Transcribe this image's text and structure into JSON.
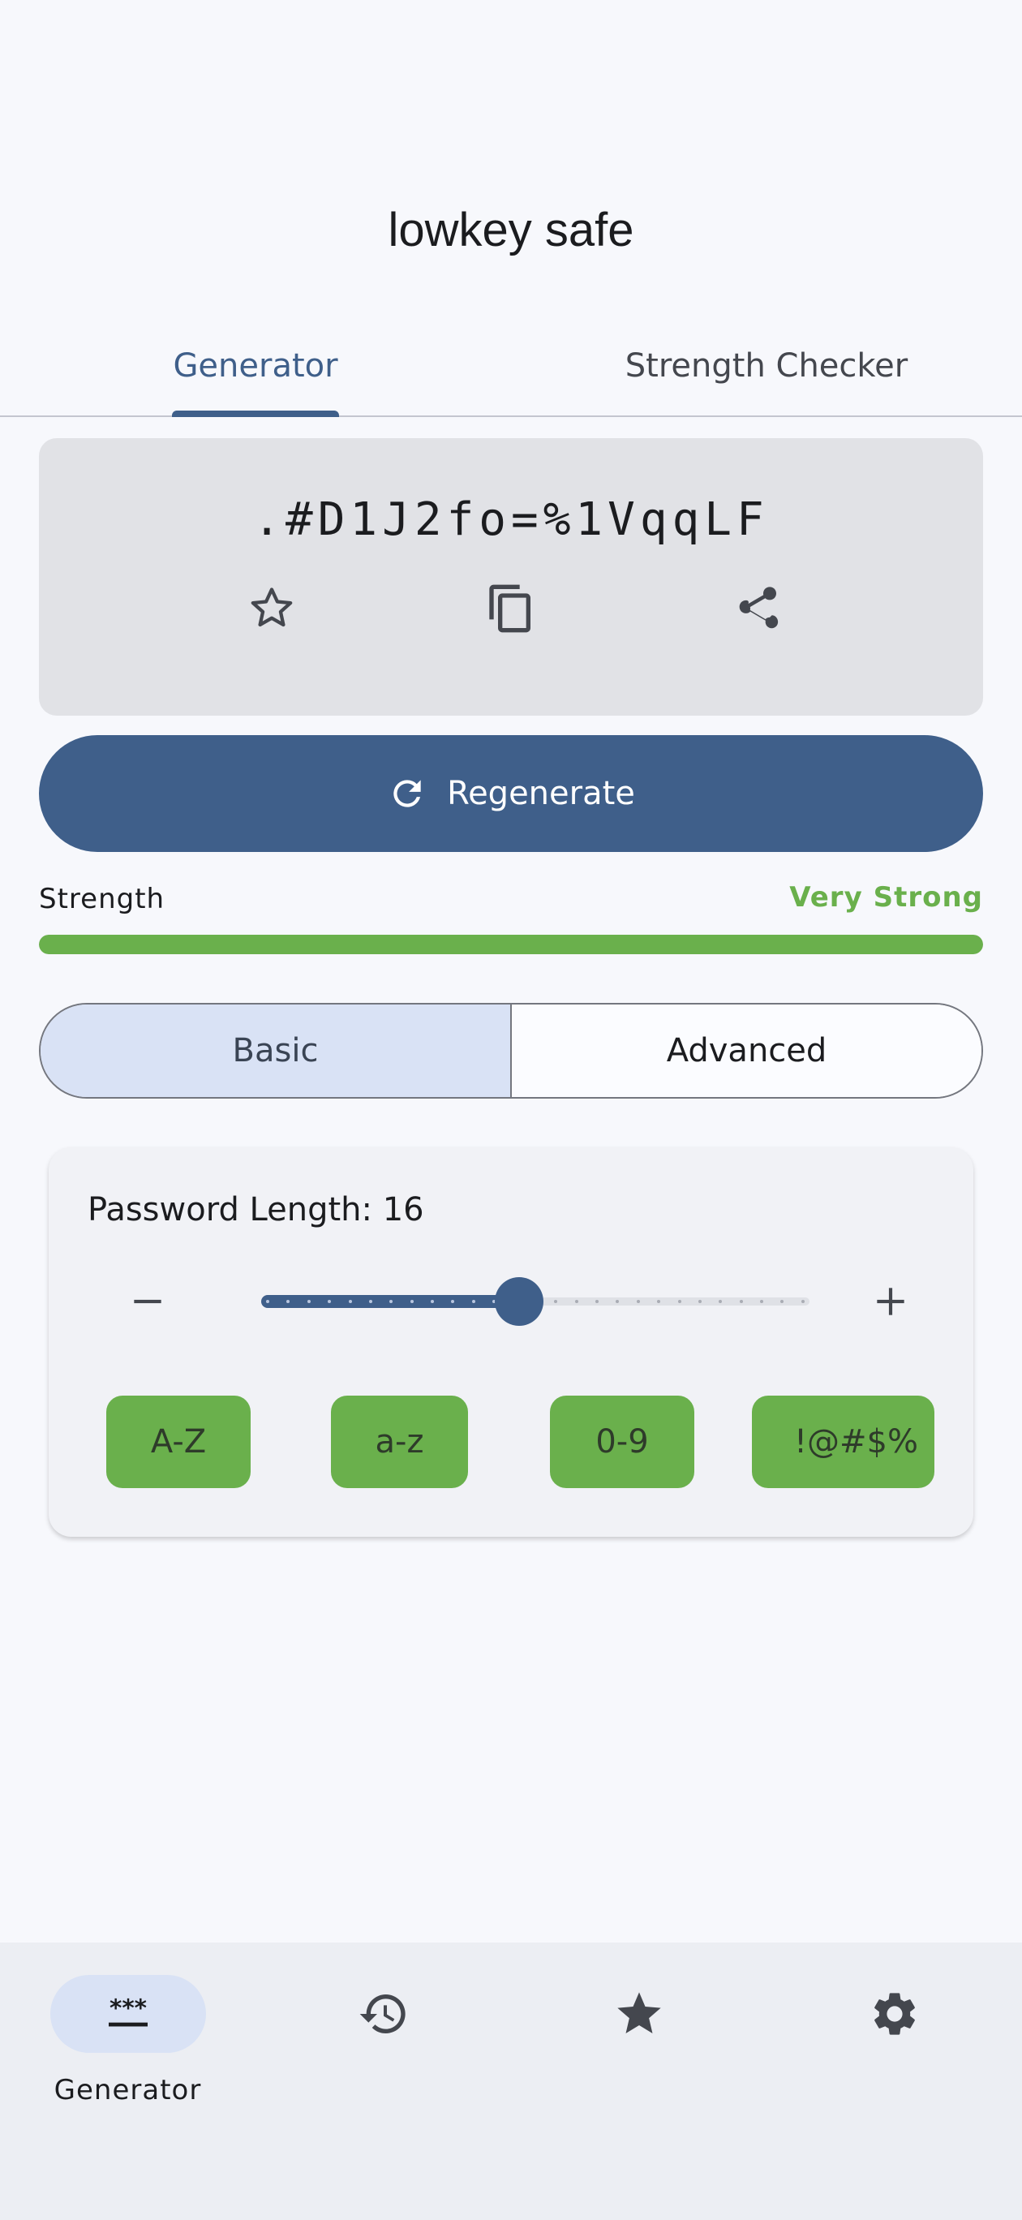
{
  "app": {
    "title": "lowkey safe"
  },
  "tabs": [
    {
      "label": "Generator",
      "active": true
    },
    {
      "label": "Strength Checker",
      "active": false
    }
  ],
  "password": {
    "value": ".#D1J2fo=%1VqqLF",
    "actions": [
      "star-outline-icon",
      "copy-icon",
      "share-icon"
    ]
  },
  "regenerate": {
    "label": "Regenerate",
    "icon": "refresh-icon"
  },
  "strength": {
    "label": "Strength",
    "value": "Very Strong",
    "level": 1.0,
    "color": "#6ab04c"
  },
  "mode": {
    "options": [
      "Basic",
      "Advanced"
    ],
    "selected": "Basic"
  },
  "options": {
    "length_label": "Password Length: 16",
    "length": 16,
    "slider_level": 0.47,
    "charsets": [
      "A-Z",
      "a-z",
      "0-9",
      "!@#$%"
    ]
  },
  "bottom_nav": [
    {
      "label": "Generator",
      "icon": "password-icon",
      "active": true
    },
    {
      "label": "",
      "icon": "history-icon",
      "active": false
    },
    {
      "label": "",
      "icon": "star-filled-icon",
      "active": false
    },
    {
      "label": "",
      "icon": "settings-icon",
      "active": false
    }
  ],
  "colors": {
    "primary": "#3f5f8a",
    "success": "#6ab04c",
    "background": "#f7f8fc"
  }
}
